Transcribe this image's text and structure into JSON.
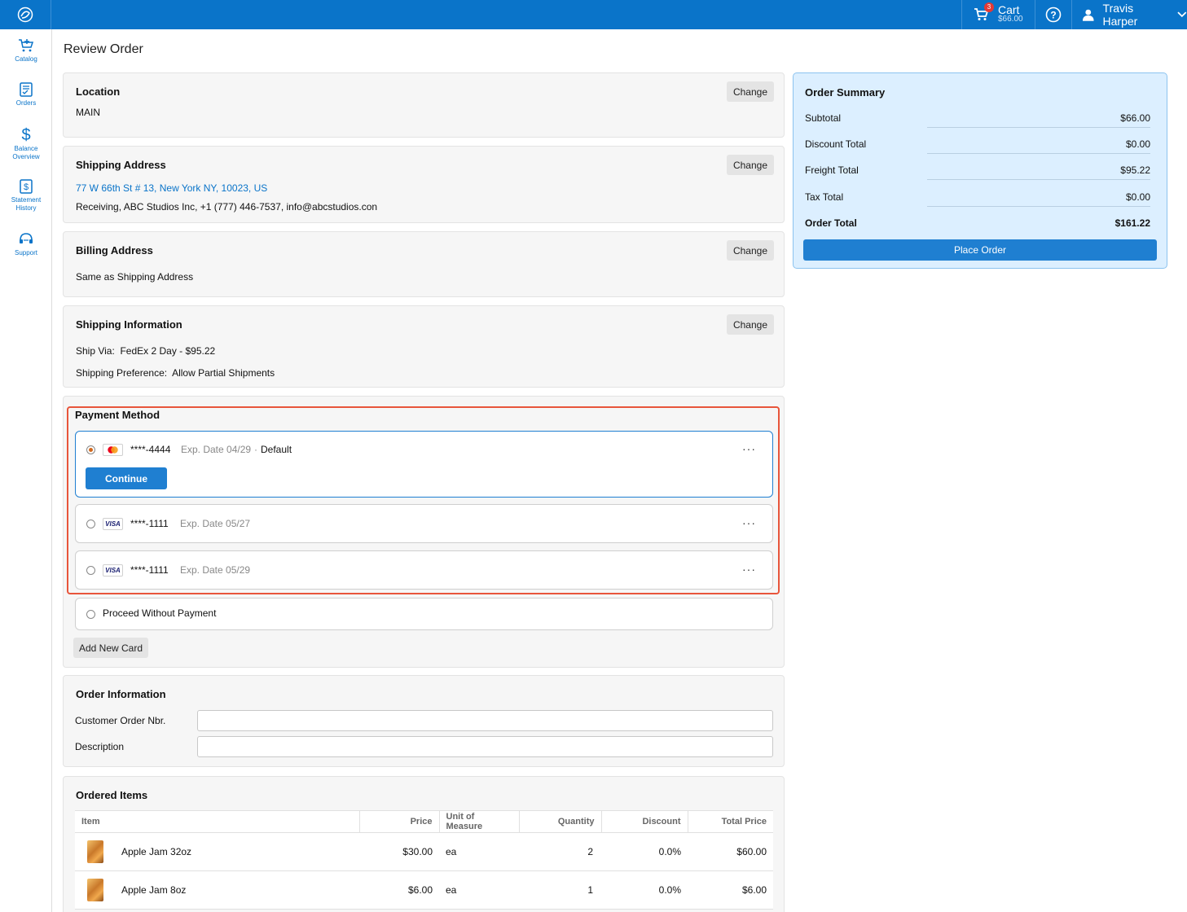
{
  "header": {
    "cart_label": "Cart",
    "cart_amount": "$66.00",
    "cart_count": "3",
    "user_name": "Travis Harper"
  },
  "sidebar": {
    "items": [
      {
        "label": "Catalog",
        "icon": "cart-plus-icon"
      },
      {
        "label": "Orders",
        "icon": "orders-icon"
      },
      {
        "label": "Balance Overview",
        "icon": "dollar-icon"
      },
      {
        "label": "Statement History",
        "icon": "statement-icon"
      },
      {
        "label": "Support",
        "icon": "headset-icon"
      }
    ]
  },
  "page": {
    "title": "Review Order"
  },
  "location": {
    "title": "Location",
    "value": "MAIN",
    "change": "Change"
  },
  "shipping_address": {
    "title": "Shipping Address",
    "address": "77 W 66th St # 13, New York NY, 10023, US",
    "contact": "Receiving, ABC Studios Inc, +1 (777) 446-7537, info@abcstudios.con",
    "change": "Change"
  },
  "billing_address": {
    "title": "Billing Address",
    "value": "Same as Shipping Address",
    "change": "Change"
  },
  "shipping_info": {
    "title": "Shipping Information",
    "ship_via": "Ship Via:  FedEx 2 Day - $95.22",
    "preference": "Shipping Preference:  Allow Partial Shipments",
    "change": "Change"
  },
  "payment": {
    "title": "Payment Method",
    "cards": [
      {
        "brand": "mastercard",
        "number": "****-4444",
        "exp": "Exp. Date 04/29",
        "default": "Default",
        "selected": true
      },
      {
        "brand": "VISA",
        "number": "****-1111",
        "exp": "Exp. Date 05/27",
        "selected": false
      },
      {
        "brand": "VISA",
        "number": "****-1111",
        "exp": "Exp. Date 05/29",
        "selected": false
      }
    ],
    "separator": "·",
    "more": "···",
    "continue_label": "Continue",
    "no_payment_label": "Proceed Without Payment",
    "add_card_label": "Add New Card"
  },
  "order_info": {
    "title": "Order Information",
    "customer_order_label": "Customer Order Nbr.",
    "customer_order_value": "",
    "description_label": "Description",
    "description_value": ""
  },
  "items": {
    "title": "Ordered Items",
    "columns": [
      "Item",
      "Price",
      "Unit of Measure",
      "Quantity",
      "Discount",
      "Total Price"
    ],
    "rows": [
      {
        "name": "Apple Jam 32oz",
        "price": "$30.00",
        "uom": "ea",
        "qty": "2",
        "discount": "0.0%",
        "total": "$60.00"
      },
      {
        "name": "Apple Jam 8oz",
        "price": "$6.00",
        "uom": "ea",
        "qty": "1",
        "discount": "0.0%",
        "total": "$6.00"
      }
    ]
  },
  "summary": {
    "title": "Order Summary",
    "subtotal_label": "Subtotal",
    "subtotal": "$66.00",
    "discount_label": "Discount Total",
    "discount": "$0.00",
    "freight_label": "Freight Total",
    "freight": "$95.22",
    "tax_label": "Tax Total",
    "tax": "$0.00",
    "total_label": "Order Total",
    "total": "$161.22",
    "place_order": "Place Order"
  },
  "colors": {
    "primary": "#0a74c9",
    "button": "#1f7fd1",
    "highlight": "#e8553b",
    "summary_bg": "#dcefff"
  }
}
